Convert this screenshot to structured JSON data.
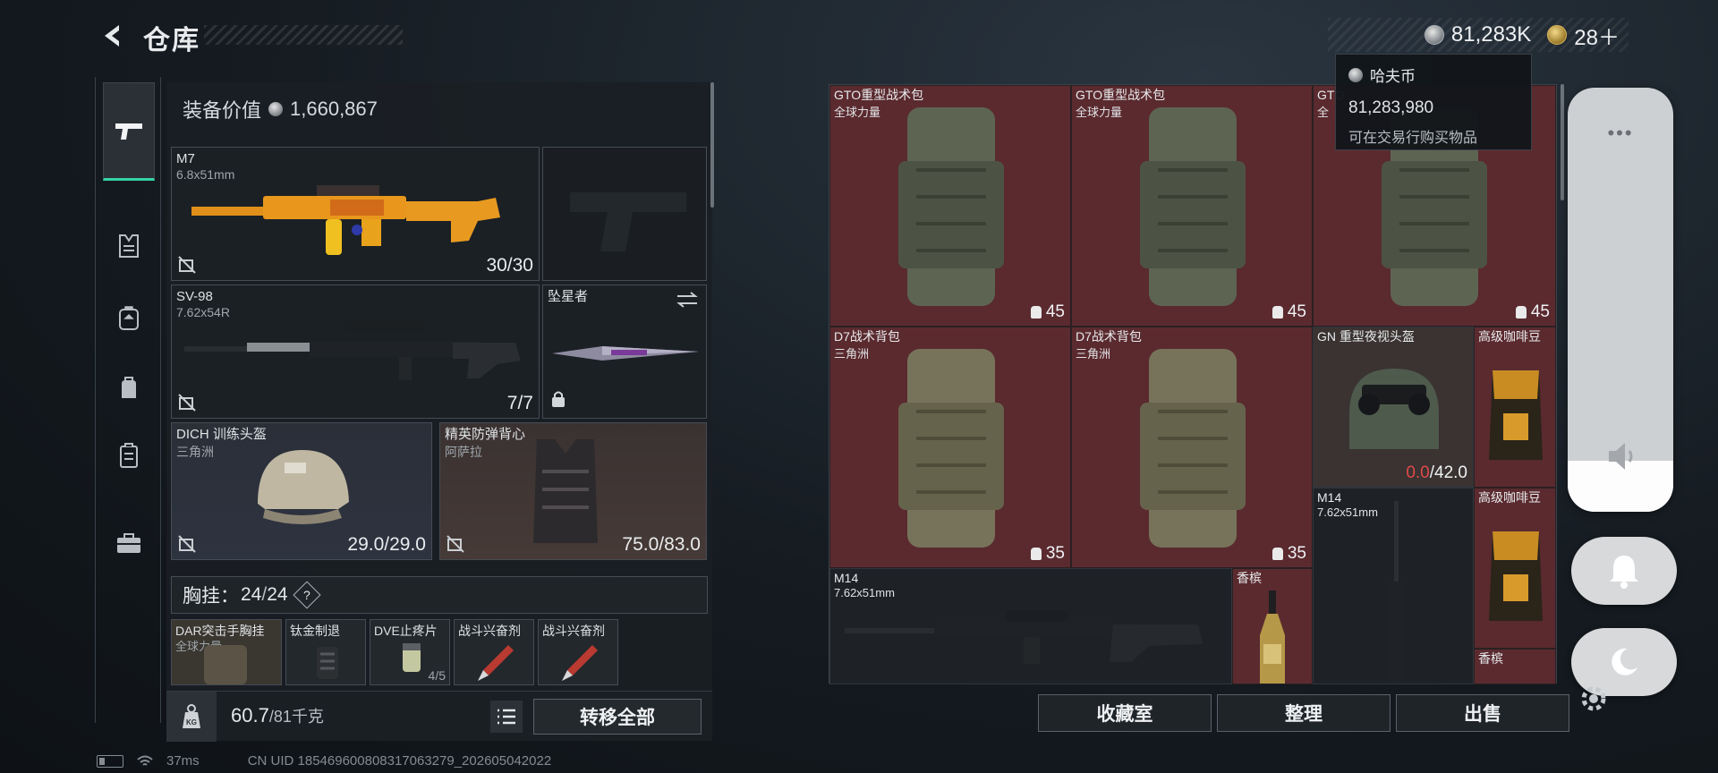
{
  "header": {
    "title": "仓库",
    "currency": [
      {
        "icon": "silver-coin-icon",
        "value": "81,283K"
      },
      {
        "icon": "gold-coin-icon",
        "value": "28＋"
      }
    ]
  },
  "tooltip": {
    "title": "哈夫币",
    "value": "81,283,980",
    "desc": "可在交易行购买物品"
  },
  "rail": {
    "items": [
      "pistol-icon",
      "armor-icon",
      "backpack-icon",
      "bag-icon",
      "case-icon",
      "toolbox-icon"
    ],
    "active_index": 0
  },
  "equipment": {
    "value_label": "装备价值",
    "value": "1,660,867",
    "primary": {
      "name": "M7",
      "caliber": "6.8x51mm",
      "ammo": "30/30"
    },
    "pistol": {
      "name": ""
    },
    "secondary": {
      "name": "SV-98",
      "caliber": "7.62x54R",
      "ammo": "7/7"
    },
    "melee": {
      "name": "坠星者"
    },
    "helmet": {
      "name": "DICH 训练头盔",
      "brand": "三角洲",
      "durability": "29.0/29.0"
    },
    "vest": {
      "name": "精英防弹背心",
      "brand": "阿萨拉",
      "durability": "75.0/83.0"
    },
    "rig": {
      "label": "胸挂：",
      "capacity": "24",
      "max": "24",
      "help": "?"
    },
    "rig_items": [
      {
        "name": "DAR突击手胸挂",
        "sub": "全球力量",
        "count": ""
      },
      {
        "name": "钛金制退",
        "sub": "",
        "count": ""
      },
      {
        "name": "DVE止疼片",
        "sub": "",
        "count": "4/5"
      },
      {
        "name": "战斗兴奋剂",
        "sub": "",
        "count": ""
      },
      {
        "name": "战斗兴奋剂",
        "sub": "",
        "count": ""
      }
    ],
    "weight": "60.7",
    "weight_max": "/81千克",
    "weight_icon_text": "KG",
    "transfer_all": "转移全部"
  },
  "stash": {
    "items": [
      {
        "name": "GTO重型战术包",
        "sub": "全球力量",
        "count": "45"
      },
      {
        "name": "GTO重型战术包",
        "sub": "全球力量",
        "count": "45"
      },
      {
        "name": "GTO",
        "sub": "全",
        "count": "45"
      },
      {
        "name": "D7战术背包",
        "sub": "三角洲",
        "count": "35"
      },
      {
        "name": "D7战术背包",
        "sub": "三角洲",
        "count": "35"
      },
      {
        "name": "GN 重型夜视头盔",
        "sub": "",
        "dur_cur": "0.0",
        "dur_max": "/42.0"
      },
      {
        "name": "高级咖啡豆",
        "sub": ""
      },
      {
        "name": "M14",
        "sub": "7.62x51mm"
      },
      {
        "name": "高级咖啡豆",
        "sub": ""
      },
      {
        "name": "M14",
        "sub": "7.62x51mm"
      },
      {
        "name": "香槟",
        "sub": ""
      },
      {
        "name": "香槟",
        "sub": ""
      }
    ],
    "buttons": [
      "收藏室",
      "整理",
      "出售"
    ]
  },
  "overlay": {
    "dots": "•••",
    "volume_level": 0.12
  },
  "status": {
    "ping": "37ms",
    "uid": "CN UID 18546960080831706327​9_202605042022"
  }
}
